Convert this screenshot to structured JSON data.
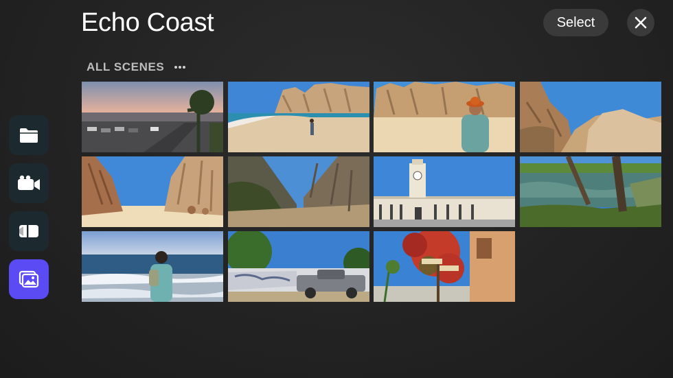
{
  "header": {
    "title": "Echo Coast",
    "select_label": "Select"
  },
  "section": {
    "label": "ALL SCENES"
  },
  "sidebar": {
    "items": [
      {
        "icon": "folder-icon",
        "active": false
      },
      {
        "icon": "video-camera-icon",
        "active": false
      },
      {
        "icon": "clip-icon",
        "active": false
      },
      {
        "icon": "photos-icon",
        "active": true
      }
    ]
  },
  "scenes": [
    {
      "subject": "palm street with parked cars at dusk"
    },
    {
      "subject": "person walking on sandy beach by rocks"
    },
    {
      "subject": "woman in orange hat facing rock cliffs"
    },
    {
      "subject": "rocky cliff against blue sky"
    },
    {
      "subject": "beach between tall rock walls"
    },
    {
      "subject": "canyon path between rocky hills"
    },
    {
      "subject": "white clock tower building"
    },
    {
      "subject": "green lagoon with palm trunks"
    },
    {
      "subject": "girl with backpack looking at sea"
    },
    {
      "subject": "pickup truck by graffiti wall"
    },
    {
      "subject": "street signs with red bougainvillea"
    }
  ],
  "colors": {
    "accent": "#5b4bf5",
    "sidebar_bg": "#1c2a30",
    "button_bg": "#3a3a3a"
  }
}
